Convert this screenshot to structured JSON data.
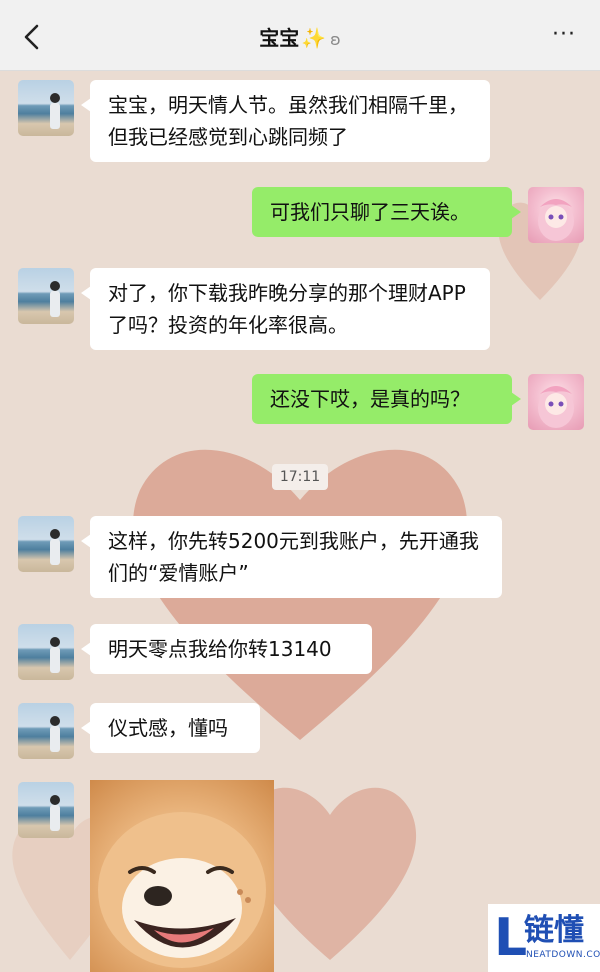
{
  "header": {
    "title": "宝宝",
    "sparkle": "✨",
    "ear_icon": "ear-icon",
    "more": "···"
  },
  "messages": [
    {
      "side": "left",
      "text": "宝宝，明天情人节。虽然我们相隔千里，但我已经感觉到心跳同频了"
    },
    {
      "side": "right",
      "text": "可我们只聊了三天诶。"
    },
    {
      "side": "left",
      "text": "对了，你下载我昨晚分享的那个理财APP了吗？投资的年化率很高。"
    },
    {
      "side": "right",
      "text": "还没下哎，是真的吗？"
    },
    {
      "side": "left",
      "text": "这样，你先转5200元到我账户，先开通我们的“爱情账户”"
    },
    {
      "side": "left",
      "text": "明天零点我给你转13140"
    },
    {
      "side": "left",
      "text": "仪式感，懂吗"
    }
  ],
  "timestamp": "17:11",
  "watermark": {
    "logo_letter": "L",
    "brand": "链懂",
    "domain": "NEATDOWN.COM"
  },
  "colors": {
    "sent_bubble": "#95ec69",
    "received_bubble": "#ffffff",
    "header_bg": "#f1f1f1"
  }
}
